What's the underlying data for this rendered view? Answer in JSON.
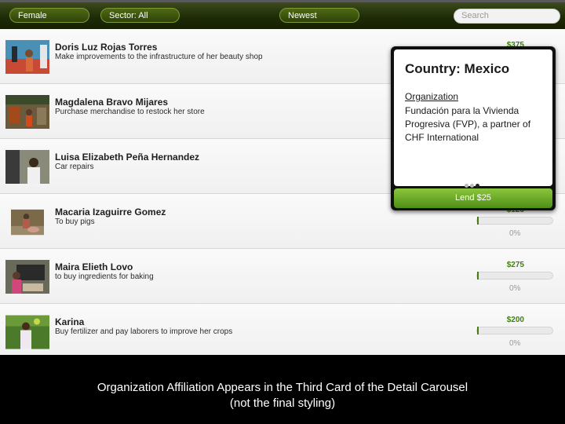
{
  "toolbar": {
    "gender_filter": "Female",
    "sector_filter": "Sector: All",
    "sort": "Newest",
    "search_placeholder": "Search"
  },
  "loans": [
    {
      "name": "Doris Luz Rojas Torres",
      "use": "Make improvements to the infrastructure of her beauty shop",
      "amount": "$375",
      "funded_percent": "0%"
    },
    {
      "name": "Magdalena Bravo Mijares",
      "use": "Purchase merchandise to restock her store",
      "amount": "",
      "funded_percent": ""
    },
    {
      "name": "Luisa Elizabeth Peña Hernandez",
      "use": "Car repairs",
      "amount": "",
      "funded_percent": ""
    },
    {
      "name": "Macaria Izaguirre Gomez",
      "use": "To buy pigs",
      "amount": "$125",
      "funded_percent": "0%"
    },
    {
      "name": "Maira Elieth Lovo",
      "use": "to buy ingredients for baking",
      "amount": "$275",
      "funded_percent": "0%"
    },
    {
      "name": "Karina",
      "use": "Buy fertilizer and pay laborers to improve her crops",
      "amount": "$200",
      "funded_percent": "0%"
    }
  ],
  "detail": {
    "title": "Country: Mexico",
    "section_label": "Organization",
    "section_text": "Fundación para la Vivienda Progresiva (FVP), a partner of CHF International",
    "card_index": 3,
    "card_count": 3,
    "lend_label": "Lend $25"
  },
  "caption": {
    "line1": "Organization Affiliation Appears in the Third Card of the Detail Carousel",
    "line2": "(not the final styling)"
  },
  "colors": {
    "toolbar": "#1d2a06",
    "accent_green": "#4f8f16",
    "amount_green": "#3f7f12"
  }
}
